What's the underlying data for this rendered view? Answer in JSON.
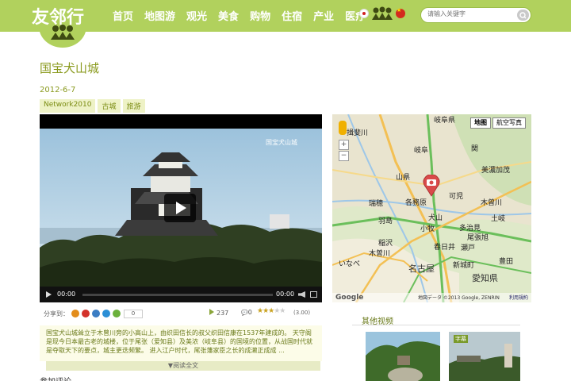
{
  "header": {
    "logo": "友邻行",
    "nav": [
      "首页",
      "地图游",
      "观光",
      "美食",
      "购物",
      "住宿",
      "产业",
      "医疗"
    ],
    "search_placeholder": "请输入关键字"
  },
  "page": {
    "title": "国宝犬山城",
    "date": "2012-6-7",
    "tags": [
      "Network2010",
      "古城",
      "旅游"
    ]
  },
  "video": {
    "watermark": "国宝犬山城",
    "time_current": "00:00",
    "time_total": "00:00"
  },
  "share": {
    "label": "分享到：",
    "count": "0",
    "views": "237",
    "comments": "0",
    "rating": "(3.00)"
  },
  "description": {
    "text": "国宝犬山城耸立于木曾川旁的小高山上，由织田信长的叔父织田信康在1537年建成的。 天守阁是现今日本最古老的城楼，位于尾张（爱知县）及美浓（岐阜县）的国境的位置，从战国时代就是夺取天下的要点，城主更迭频繁。 进入江户时代，尾张藩家臣之长的成濑正成成 ...",
    "read_more": "▼阅读全文",
    "next_section": "参加评论"
  },
  "map": {
    "type_map": "地图",
    "type_satellite": "航空写真",
    "zoom_in": "+",
    "zoom_out": "−",
    "labels": [
      "岐阜県",
      "揖斐川",
      "岐阜",
      "関",
      "美濃加茂",
      "山県",
      "各務原",
      "可児",
      "瑞穂",
      "羽島",
      "犬山",
      "小牧",
      "多治見",
      "木曾川",
      "稲沢",
      "土岐",
      "春日井",
      "瀬戸",
      "いなべ",
      "木曽川",
      "名古屋",
      "愛知県",
      "豊田",
      "新城町",
      "尾張旭"
    ],
    "copyright": "地図データ ©2013 Google, ZENRIN",
    "terms": "利用規約",
    "google": "Google"
  },
  "other_videos": {
    "title": "其他视频",
    "thumb_tag": "字幕"
  }
}
